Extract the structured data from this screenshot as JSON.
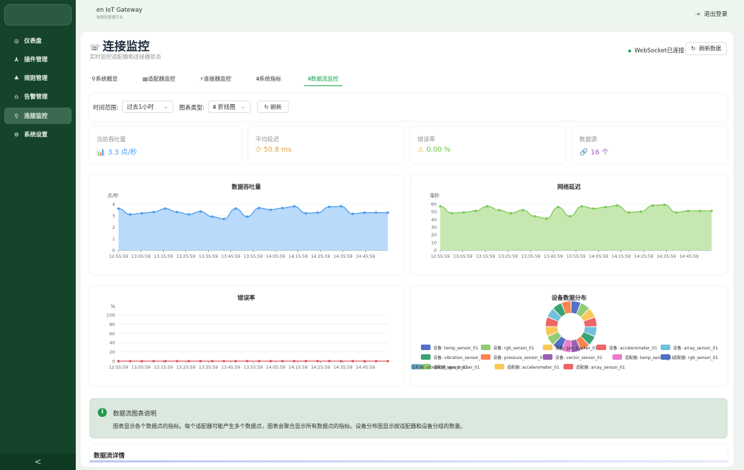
{
  "app": {
    "title": "en IoT Gateway",
    "subtitle": "物联网管理平台",
    "logout": "退出登录"
  },
  "sidebar": {
    "items": [
      {
        "icon": "◎",
        "label": "仪表盘"
      },
      {
        "icon": "⅄",
        "label": "插件管理"
      },
      {
        "icon": "♣",
        "label": "规则管理"
      },
      {
        "icon": "♎",
        "label": "告警管理"
      },
      {
        "icon": "⚲",
        "label": "连接监控",
        "active": true
      },
      {
        "icon": "⚙",
        "label": "系统设置"
      }
    ],
    "collapse": "<"
  },
  "page": {
    "icon": "☏",
    "title": "连接监控",
    "subtitle": "实时监控适配器和连接器状态",
    "ws_status": "WebSocket已连接",
    "refresh": "刷新数据",
    "refresh_icon": "↻"
  },
  "tabs": [
    {
      "label": "⚲系统概览"
    },
    {
      "label": "▤适配器监控"
    },
    {
      "label": "⚡连接器监控"
    },
    {
      "label": "⩩系统指标"
    },
    {
      "label": "⩩数据流监控",
      "active": true
    }
  ],
  "filters": {
    "time_label": "时间范围:",
    "time_value": "过去1小时",
    "chart_label": "图表类型:",
    "chart_value": "⩩ 折线图",
    "refresh": "↻  刷新",
    "chevron": "⌄"
  },
  "metrics": [
    {
      "label": "当前吞吐量",
      "icon": "📊",
      "value": "3.3 点/秒",
      "color": "#409eff"
    },
    {
      "label": "平均延迟",
      "icon": "⏱",
      "value": "50.8 ms",
      "color": "#e6a23c"
    },
    {
      "label": "错误率",
      "icon": "⚠",
      "value": "0.00 %",
      "color": "#67c23a"
    },
    {
      "label": "数据源",
      "icon": "🔗",
      "value": "16 个",
      "color": "#9b59b6"
    }
  ],
  "info": {
    "icon": "i",
    "title": "数据流图表说明",
    "body": "图表显示各个数据点的指标。每个适配器可能产生多个数据点，图表会聚合显示所有数据点的指标。设备分布图显示按适配器和设备分组的数量。"
  },
  "detail": {
    "title": "数据流详情"
  },
  "chart_data": [
    {
      "type": "area",
      "title": "数据吞吐量",
      "ylabel": "点/秒",
      "ylim": [
        0,
        4
      ],
      "yticks": [
        0,
        1,
        2,
        3,
        4
      ],
      "color": "#4b9bea",
      "fill": "#b9dafb",
      "xticks": [
        "12:55:59",
        "13:05:59",
        "13:15:59",
        "13:25:59",
        "13:35:59",
        "13:45:59",
        "13:55:59",
        "14:05:59",
        "14:15:59",
        "14:25:59",
        "14:35:59",
        "14:45:59"
      ],
      "values": [
        3.6,
        3.1,
        3.2,
        3.3,
        3.6,
        3.3,
        3.1,
        3.35,
        2.9,
        2.7,
        3.6,
        2.9,
        3.65,
        3.5,
        3.65,
        3.8,
        3.2,
        3.25,
        3.75,
        3.8,
        3.15,
        3.25,
        3.25,
        3.25
      ]
    },
    {
      "type": "area",
      "title": "网络延迟",
      "ylabel": "毫秒",
      "ylim": [
        0,
        60
      ],
      "yticks": [
        0,
        10,
        20,
        30,
        40,
        50,
        60
      ],
      "color": "#7cc855",
      "fill": "#c6e8b0",
      "xticks": [
        "12:55:59",
        "13:05:59",
        "13:15:59",
        "13:25:59",
        "13:35:59",
        "13:45:59",
        "13:55:59",
        "14:05:59",
        "14:15:59",
        "14:25:59",
        "14:35:59",
        "14:45:59"
      ],
      "values": [
        57,
        48,
        49,
        51,
        57,
        52,
        48,
        52,
        44,
        41,
        56,
        44,
        57,
        54,
        56,
        58,
        49,
        50,
        58,
        59,
        49,
        51,
        51,
        51
      ]
    },
    {
      "type": "line",
      "title": "错误率",
      "ylabel": "%",
      "ylim": [
        0,
        100
      ],
      "yticks": [
        0,
        20,
        40,
        60,
        80,
        100
      ],
      "color": "#e0505a",
      "xticks": [
        "12:55:59",
        "13:05:59",
        "13:15:59",
        "13:25:59",
        "13:35:59",
        "13:45:59",
        "13:55:59",
        "14:05:59",
        "14:15:59",
        "14:25:59",
        "14:35:59",
        "14:45:59"
      ],
      "values": [
        0,
        0,
        0,
        0,
        0,
        0,
        0,
        0,
        0,
        0,
        0,
        0,
        0,
        0,
        0,
        0,
        0,
        0,
        0,
        0,
        0,
        0,
        0,
        0
      ]
    },
    {
      "type": "pie",
      "title": "设备数据分布",
      "series": [
        {
          "name": "设备: temp_sensor_01",
          "color": "#5470c6",
          "value": 1
        },
        {
          "name": "设备: rgb_sensor_01",
          "color": "#91cc75",
          "value": 1
        },
        {
          "name": "设备: gps_tracker_01",
          "color": "#fac858",
          "value": 1
        },
        {
          "name": "设备: accelerometer_01",
          "color": "#ee6666",
          "value": 1
        },
        {
          "name": "设备: array_sensor_01",
          "color": "#73c0de",
          "value": 1
        },
        {
          "name": "设备: vibration_sensor_01",
          "color": "#3ba272",
          "value": 1
        },
        {
          "name": "设备: pressure_sensor_01",
          "color": "#fc8452",
          "value": 1
        },
        {
          "name": "设备: vector_sensor_01",
          "color": "#9a60b4",
          "value": 1
        },
        {
          "name": "适配器: temp_sensor_01",
          "color": "#ea7ccc",
          "value": 1
        },
        {
          "name": "适配器: rgb_sensor_01",
          "color": "#5470c6",
          "value": 1
        },
        {
          "name": "适配器: gps_tracker_01",
          "color": "#91cc75",
          "value": 1
        },
        {
          "name": "适配器: accelerometer_01",
          "color": "#fac858",
          "value": 1
        },
        {
          "name": "适配器: array_sensor_01",
          "color": "#ee6666",
          "value": 1
        },
        {
          "name": "适配器: vibration_sensor_01",
          "color": "#73c0de",
          "value": 1
        },
        {
          "name": "适配器: pressure_sensor_01",
          "color": "#3ba272",
          "value": 1
        },
        {
          "name": "适配器: vector_sensor_01",
          "color": "#fc8452",
          "value": 1
        }
      ]
    }
  ]
}
